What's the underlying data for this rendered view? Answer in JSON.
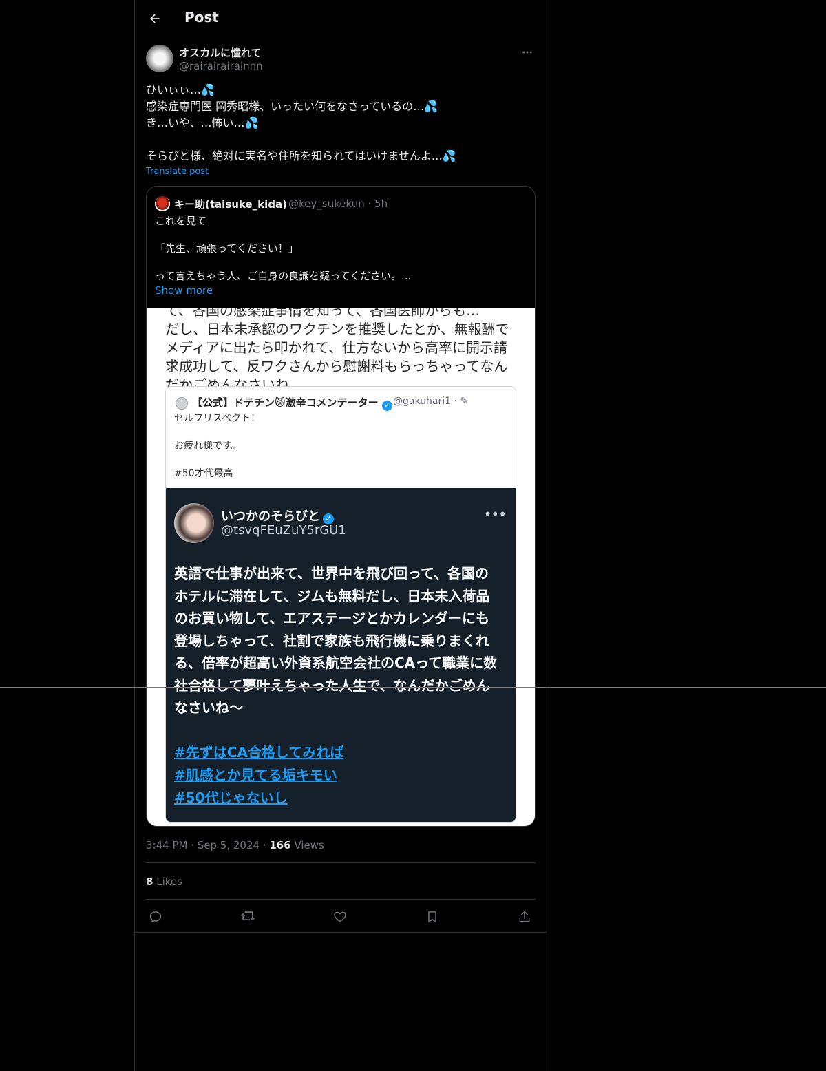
{
  "header": {
    "title": "Post"
  },
  "post": {
    "author": {
      "display_name": "オスカルに憧れて",
      "handle": "@rairairairainnn"
    },
    "text_lines": [
      "ひいぃぃ…💦",
      "感染症専門医 岡秀昭様、いったい何をなさっているの…💦",
      "き…いや、…怖い…💦",
      "",
      "そらびと様、絶対に実名や住所を知られてはいけませんよ…💦"
    ],
    "translate_label": "Translate post",
    "timestamp": "3:44 PM · Sep 5, 2024",
    "views_count": "166",
    "views_label": " Views",
    "likes_count": "8",
    "likes_label": " Likes"
  },
  "quote": {
    "name": "キー助(taisuke_kida)",
    "handle": "@key_sukekun",
    "time": "5h",
    "text_lines": [
      "これを見て",
      "",
      "「先生、頑張ってください！」",
      "",
      "って言えちゃう人、ご自身の良識を疑ってください。..."
    ],
    "show_more": "Show more",
    "image": {
      "top_text_lines": [
        "て、各国の感染症事情を知って、各国医師からも…",
        "だし、日本未承認のワクチンを推奨したとか、無報酬で",
        "メディアに出たら叩かれて、仕方ないから高率に開示請",
        "求成功して、反ワクさんから慰謝料もらっちゃってなん",
        "だかごめんなさいね。"
      ],
      "inner": {
        "name": "【公式】ドテチン😾激辛コメンテーター",
        "handle": "@gakuhari1 · ✎",
        "text_lines": [
          "セルフリスペクト！",
          "",
          "お疲れ様です。",
          "",
          "#50才代最高"
        ],
        "post": {
          "name": "いつかのそらびと",
          "handle": "@tsvqFEuZuY5rGU1",
          "body_lines": [
            "英語で仕事が出来て、世界中を飛び回って、各国の",
            "ホテルに滞在して、ジムも無料だし、日本未入荷品",
            "のお買い物して、エアステージとかカレンダーにも",
            "登場しちゃって、社割で家族も飛行機に乗りまくれ",
            "る、倍率が超高い外資系航空会社のCAって職業に数",
            "社合格して夢叶えちゃった人生で、なんだかごめん",
            "なさいね〜"
          ],
          "hashtags": [
            "#先ずはCA合格してみれば",
            "#肌感とか見てる垢キモい",
            "#50代じゃないし"
          ]
        }
      }
    }
  },
  "icons": {
    "back": "arrow-left-icon",
    "more": "more-horizontal-icon",
    "reply": "reply-icon",
    "repost": "repost-icon",
    "like": "heart-icon",
    "bookmark": "bookmark-icon",
    "share": "share-icon",
    "verified": "verified-badge-icon"
  },
  "colors": {
    "background": "#000000",
    "text": "#e7e9ea",
    "muted": "#71767b",
    "accent": "#1d9bf0",
    "border": "#2f3336"
  }
}
